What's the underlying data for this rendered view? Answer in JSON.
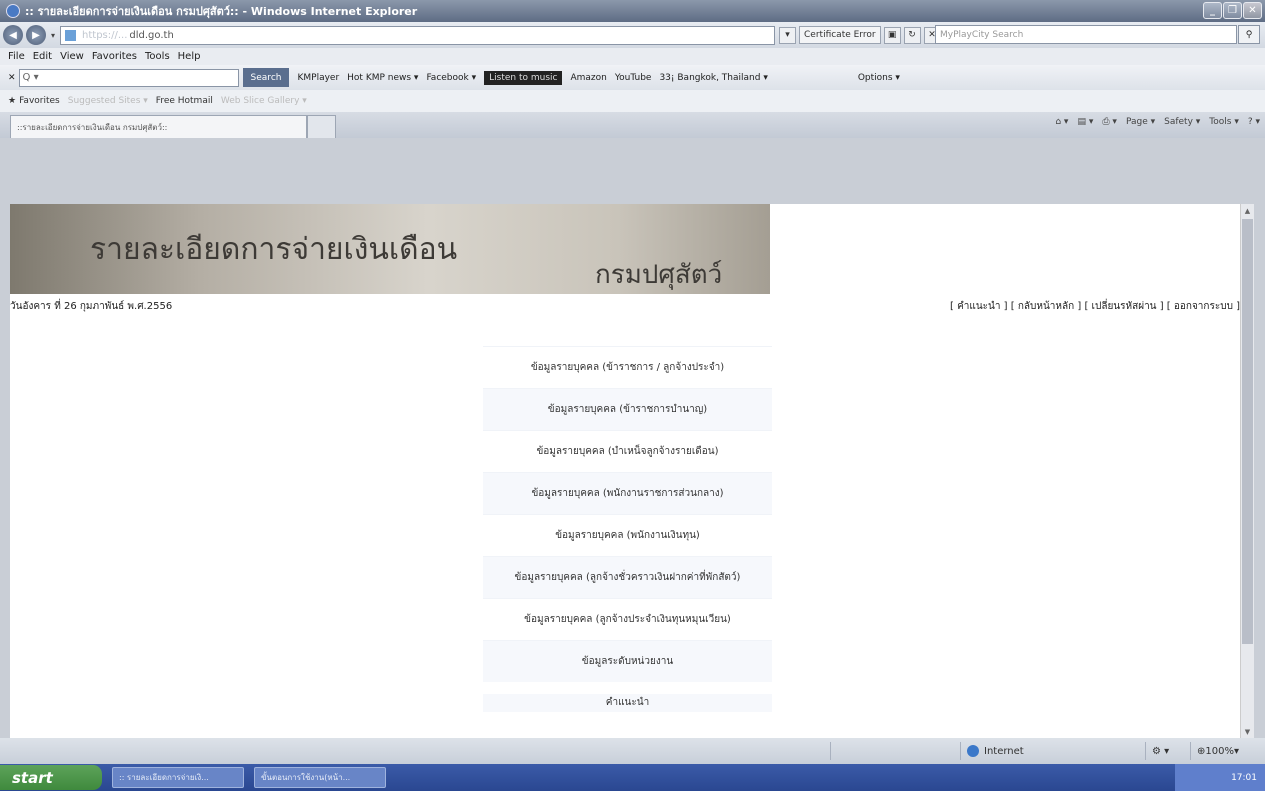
{
  "window": {
    "title": ":: รายละเอียดการจ่ายเงินเดือน กรมปศุสัตว์:: - Windows Internet Explorer"
  },
  "address": {
    "url_blurred": "https://...",
    "url_domain": "dld.go.th"
  },
  "cert": {
    "label": "Certificate Error"
  },
  "search_box": {
    "placeholder": "MyPlayCity Search"
  },
  "menu": [
    "File",
    "Edit",
    "View",
    "Favorites",
    "Tools",
    "Help"
  ],
  "toolbar": {
    "search_label": "Search",
    "items": [
      "KMPlayer",
      "Hot KMP news ▾",
      "Facebook ▾",
      "Listen to music",
      "Amazon",
      "YouTube",
      "33¡ Bangkok, Thailand ▾",
      "Options ▾"
    ]
  },
  "favorites": {
    "label": "Favorites",
    "items": [
      "Suggested Sites ▾",
      "Free Hotmail",
      "Web Slice Gallery ▾"
    ]
  },
  "tab": {
    "title": "::รายละเอียดการจ่ายเงินเดือน กรมปศุสัตว์::"
  },
  "commandbar": [
    "Page ▾",
    "Safety ▾",
    "Tools ▾"
  ],
  "banner": {
    "title": "รายละเอียดการจ่ายเงินเดือน",
    "dept": "กรมปศุสัตว์"
  },
  "date_text": "วันอังคาร ที่ 26 กุมภาพันธ์ พ.ศ.2556",
  "top_links": [
    "[ คำแนะนำ ]",
    "[ กลับหน้าหลัก ]",
    "[ เปลี่ยนรหัสผ่าน ]",
    "[ ออกจากระบบ ]"
  ],
  "menu_links": [
    "ข้อมูลรายบุคคล (ข้าราชการ / ลูกจ้างประจำ)",
    "ข้อมูลรายบุคคล (ข้าราชการบำนาญ)",
    "ข้อมูลรายบุคคล (บำเหน็จลูกจ้างรายเดือน)",
    "ข้อมูลรายบุคคล (พนักงานราชการส่วนกลาง)",
    "ข้อมูลรายบุคคล (พนักงานเงินทุน)",
    "ข้อมูลรายบุคคล (ลูกจ้างชั่วคราวเงินฝากค่าที่พักสัตว์)",
    "ข้อมูลรายบุคคล (ลูกจ้างประจำเงินทุนหมุนเวียน)",
    "ข้อมูลระดับหน่วยงาน"
  ],
  "last_link": "คำแนะนำ",
  "status": {
    "zone": "Internet",
    "zoom": "100%"
  },
  "taskbar": {
    "start": "start",
    "tasks": [
      ":: รายละเอียดการจ่ายเงิ...",
      "ขั้นตอนการใช้งาน(หน้า..."
    ],
    "time": "17:01"
  }
}
